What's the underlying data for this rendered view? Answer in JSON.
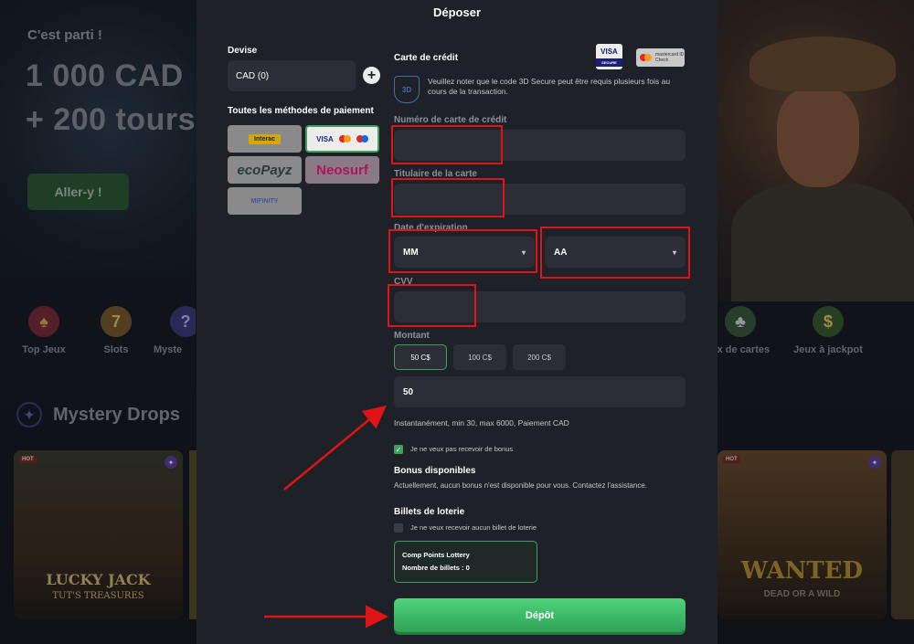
{
  "background": {
    "hero_small": "C'est parti !",
    "hero_line1": "1 000 CAD",
    "hero_line2": "+ 200 tours",
    "cta": "Aller-y !",
    "categories": [
      "Top Jeux",
      "Slots",
      "Myste",
      "ux de cartes",
      "Jeux à jackpot"
    ],
    "section_title": "Mystery Drops",
    "game_left_title": "LUCKY JACK",
    "game_left_sub": "TUT'S TREASURES",
    "game_right_title": "WANTED",
    "game_right_sub": "DEAD OR A WILD",
    "hot": "HOT"
  },
  "modal": {
    "title": "Déposer",
    "currency_label": "Devise",
    "currency_value": "CAD (0)",
    "add_icon": "+",
    "methods_label": "Toutes les méthodes de paiement",
    "methods": {
      "interac": "Interac",
      "visa": "VISA",
      "ecopayz": "ecoPayz",
      "neosurf": "Neosurf",
      "mifinity": "MIFINITY"
    },
    "card_section": "Carte de crédit",
    "visa_badge": "VISA",
    "visa_badge_sub": "SECURE",
    "mc_badge": "mastercard ID Check",
    "secure_icon": "3D",
    "secure_note": "Veuillez noter que le code 3D Secure peut être requis plusieurs fois au cours de la transaction.",
    "card_number_label": "Numéro de carte de crédit",
    "holder_label": "Titulaire de la carte",
    "expiry_label": "Date d'expiration",
    "month_placeholder": "MM",
    "year_placeholder": "AA",
    "cvv_label": "CVV",
    "amount_label": "Montant",
    "amount_options": [
      "50 C$",
      "100 C$",
      "200 C$"
    ],
    "amount_value": "50",
    "limits_info": "Instantanément, min 30, max 6000, Paiement CAD",
    "no_bonus_label": "Je ne veux pas recevoir de bonus",
    "bonus_title": "Bonus disponibles",
    "bonus_text": "Actuellement, aucun bonus n'est disponible pour vous. Contactez l'assistance.",
    "lottery_title": "Billets de loterie",
    "no_lottery_label": "Je ne veux recevoir aucun billet de loterie",
    "lottery_card_title": "Comp Points Lottery",
    "lottery_card_count": "Nombre de billets : 0",
    "deposit_button": "Dépôt"
  },
  "colors": {
    "accent_green": "#3fa25a",
    "highlight_red": "#e01414",
    "modal_bg": "#1f2128",
    "field_bg": "#2b2e36"
  }
}
